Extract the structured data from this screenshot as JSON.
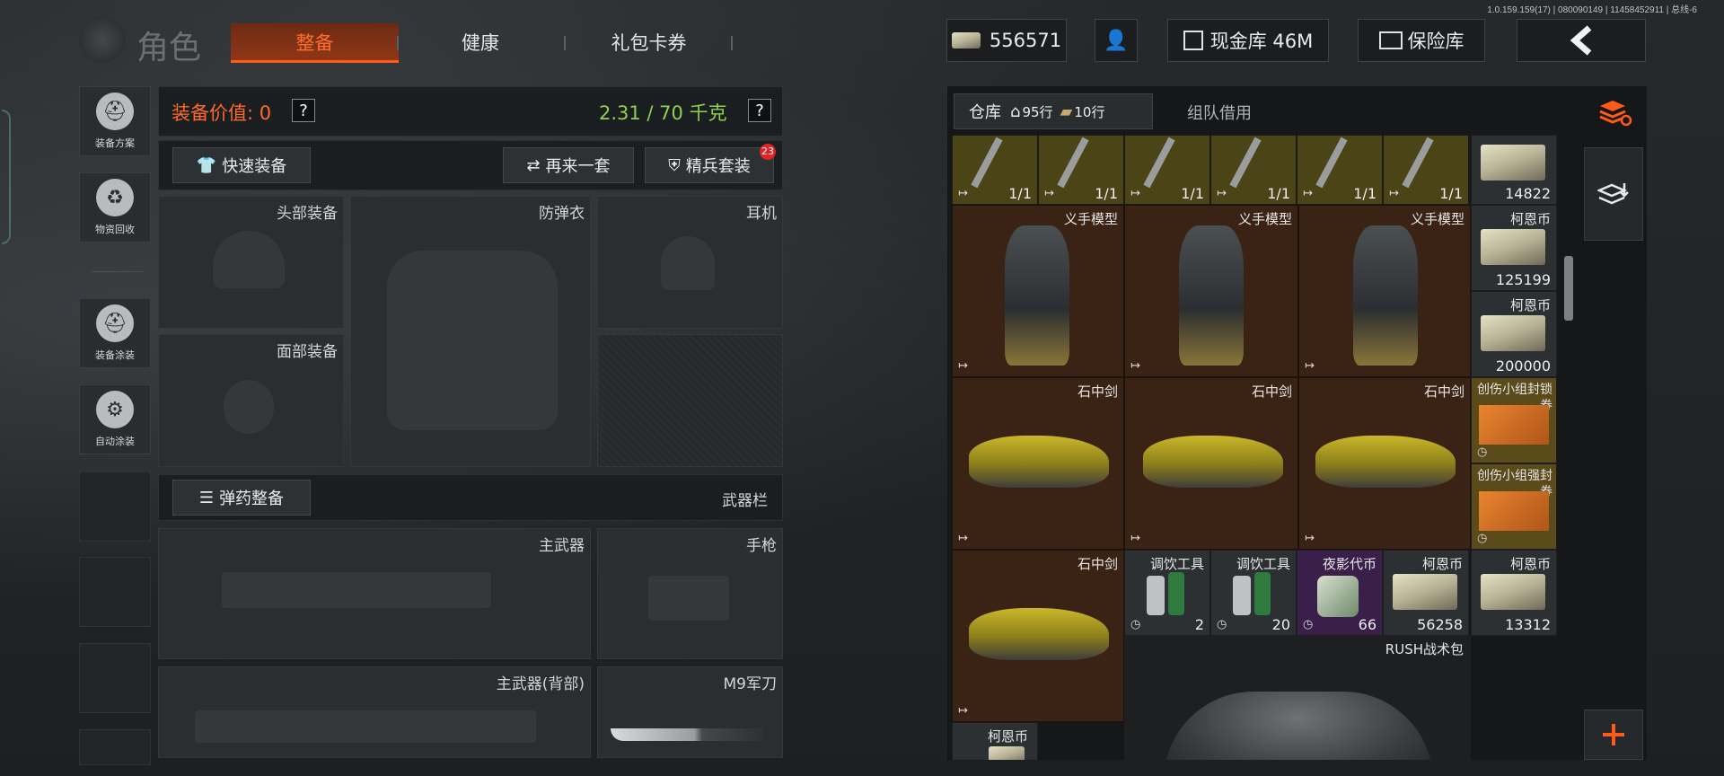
{
  "version": "1.0.159.159(17) | 080090149 | 11458452911 | 总线-6",
  "header": {
    "title": "角色",
    "tabs": [
      "整备",
      "健康",
      "礼包卡券"
    ],
    "currency": "556571",
    "cash_vault": "现金库 46M",
    "safe": "保险库"
  },
  "sidebar": {
    "items": [
      "装备方案",
      "物资回收",
      "装备涂装",
      "自动涂装"
    ]
  },
  "equip": {
    "value_label": "装备价值: 0",
    "weight": "2.31 / 70 千克",
    "help": "?",
    "quick_equip": "快速装备",
    "again": "再来一套",
    "elite_set": "精兵套装",
    "elite_badge": "23",
    "slots": {
      "head": "头部装备",
      "armor": "防弹衣",
      "earphone": "耳机",
      "face": "面部装备",
      "ammo_btn": "弹药整备",
      "weapon_bar": "武器栏",
      "primary": "主武器",
      "pistol": "手枪",
      "primary_back": "主武器(背部)",
      "knife": "M9军刀"
    }
  },
  "inventory": {
    "tab_storage": "仓库",
    "rows_home": "95行",
    "rows_ticket": "10行",
    "tab_team": "组队借用",
    "top_row_count": "1/1",
    "top_money": "14822",
    "hand_name": "义手模型",
    "sword_name": "石中剑",
    "coin_name": "柯恩币",
    "coin_vals": [
      "125199",
      "200000",
      "56258",
      "13312"
    ],
    "lock1": "创伤小组封锁券",
    "lock2": "创伤小组强封券",
    "tool_name": "调饮工具",
    "tool_counts": [
      "2",
      "20"
    ],
    "night_coin": "夜影代币",
    "night_count": "66",
    "rush_bag": "RUSH战术包"
  },
  "colors": {
    "accent": "#ff5a1a",
    "weight_green": "#8fd14f",
    "cell_olive": "#4a4416",
    "cell_brown": "#3a2214"
  }
}
